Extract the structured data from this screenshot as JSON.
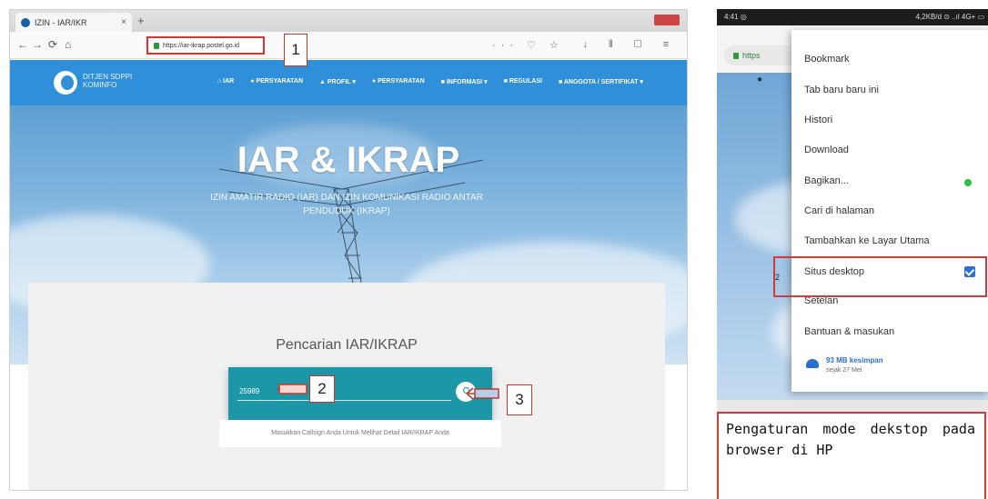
{
  "desktop_browser": {
    "tab_title": "IZIN - IAR/IKR",
    "tab_close": "×",
    "new_tab": "+",
    "nav_back": "←",
    "nav_forward": "→",
    "nav_reload": "⟳",
    "nav_home": "⌂",
    "url": "https://iar-ikrap.postel.go.id",
    "url_actions": "··· ♡ ☆",
    "toolbar_icons": "↓ ⫴ ▢ ≡"
  },
  "site": {
    "brand": "DITJEN SDPPI KOMINFO",
    "menu": [
      "⌂ IAR",
      "● PERSYARATAN",
      "▲ PROFIL ▾",
      "● PERSYARATAN",
      "■ INFORMASI ▾",
      "■ REGULASI",
      "■ ANGGOTA / SERTIFIKAT ▾"
    ],
    "hero_title": "IAR & IKRAP",
    "hero_subtitle": "IZIN AMATIR RADIO (IAR) DAN IZIN KOMUNIKASI RADIO ANTAR PENDUDUK (IKRAP)",
    "search_title": "Pencarian IAR/IKRAP",
    "search_value": "25989",
    "search_hint": "Masukkan Callsign Anda Untuk Melihat Detail IAR/IKRAP Anda"
  },
  "callouts": {
    "c1": "1",
    "c2": "2",
    "c3": "3"
  },
  "mobile": {
    "status_left": "4:41 ◎",
    "status_right": "4,2KB/d ⊙ ..ıl 4G+ ▭",
    "url": "https",
    "menu_items": [
      "Bookmark",
      "Tab baru baru ini",
      "Histori",
      "Download",
      "Bagikan...",
      "Cari di halaman",
      "Tambahkan ke Layar Utama",
      "Situs desktop",
      "Setelan",
      "Bantuan & masukan"
    ],
    "saver_title": "93 MB kesimpan",
    "saver_sub": "sejak 27 Mei",
    "highlight_label": "2",
    "caption": "Pengaturan mode dekstop pada browser di HP"
  },
  "colors": {
    "site_blue": "#2f8fd8",
    "search_teal": "#1c97a8",
    "annotation_red": "#d23a3a"
  }
}
